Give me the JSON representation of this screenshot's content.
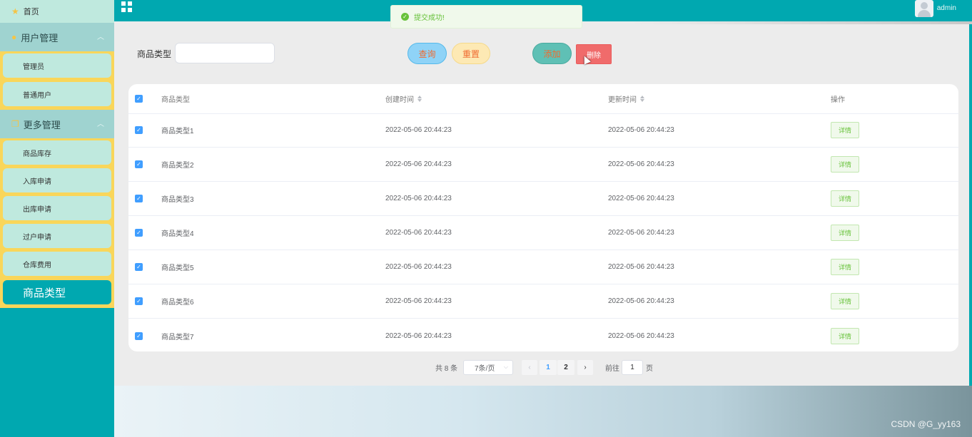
{
  "sidebar": {
    "home_label": "首页",
    "groups": [
      {
        "label": "用户管理",
        "items": [
          "管理员",
          "普通用户"
        ]
      },
      {
        "label": "更多管理",
        "items": [
          "商品库存",
          "入库申请",
          "出库申请",
          "过户申请",
          "仓库费用",
          "商品类型"
        ]
      }
    ],
    "active_item": "商品类型"
  },
  "topbar": {
    "admin_name": "admin"
  },
  "toast": {
    "message": "提交成功!"
  },
  "search": {
    "label": "商品类型",
    "value": "",
    "query_label": "查询",
    "reset_label": "重置",
    "add_label": "添加",
    "delete_label": "删除"
  },
  "table": {
    "columns": [
      "商品类型",
      "创建时间",
      "更新时间",
      "操作"
    ],
    "rows": [
      {
        "type": "商品类型1",
        "created": "2022-05-06 20:44:23",
        "updated": "2022-05-06 20:44:23",
        "action": "详情",
        "checked": true
      },
      {
        "type": "商品类型2",
        "created": "2022-05-06 20:44:23",
        "updated": "2022-05-06 20:44:23",
        "action": "详情",
        "checked": true
      },
      {
        "type": "商品类型3",
        "created": "2022-05-06 20:44:23",
        "updated": "2022-05-06 20:44:23",
        "action": "详情",
        "checked": true
      },
      {
        "type": "商品类型4",
        "created": "2022-05-06 20:44:23",
        "updated": "2022-05-06 20:44:23",
        "action": "详情",
        "checked": true
      },
      {
        "type": "商品类型5",
        "created": "2022-05-06 20:44:23",
        "updated": "2022-05-06 20:44:23",
        "action": "详情",
        "checked": true
      },
      {
        "type": "商品类型6",
        "created": "2022-05-06 20:44:23",
        "updated": "2022-05-06 20:44:23",
        "action": "详情",
        "checked": true
      },
      {
        "type": "商品类型7",
        "created": "2022-05-06 20:44:23",
        "updated": "2022-05-06 20:44:23",
        "action": "详情",
        "checked": true
      }
    ]
  },
  "pagination": {
    "total_text": "共 8 条",
    "page_size": "7条/页",
    "pages": [
      "1",
      "2"
    ],
    "current_page": "1",
    "goto_label": "前往",
    "goto_value": "1",
    "unit": "页"
  },
  "watermark": "CSDN @G_yy163",
  "colors": {
    "sidebar_bg": "#00a8b0",
    "submenu_bg": "#f9d65a",
    "menu_item_bg": "#bfe9de",
    "accent_blue": "#409eff",
    "success_green": "#67c23a",
    "danger_red": "#f06b6b"
  }
}
